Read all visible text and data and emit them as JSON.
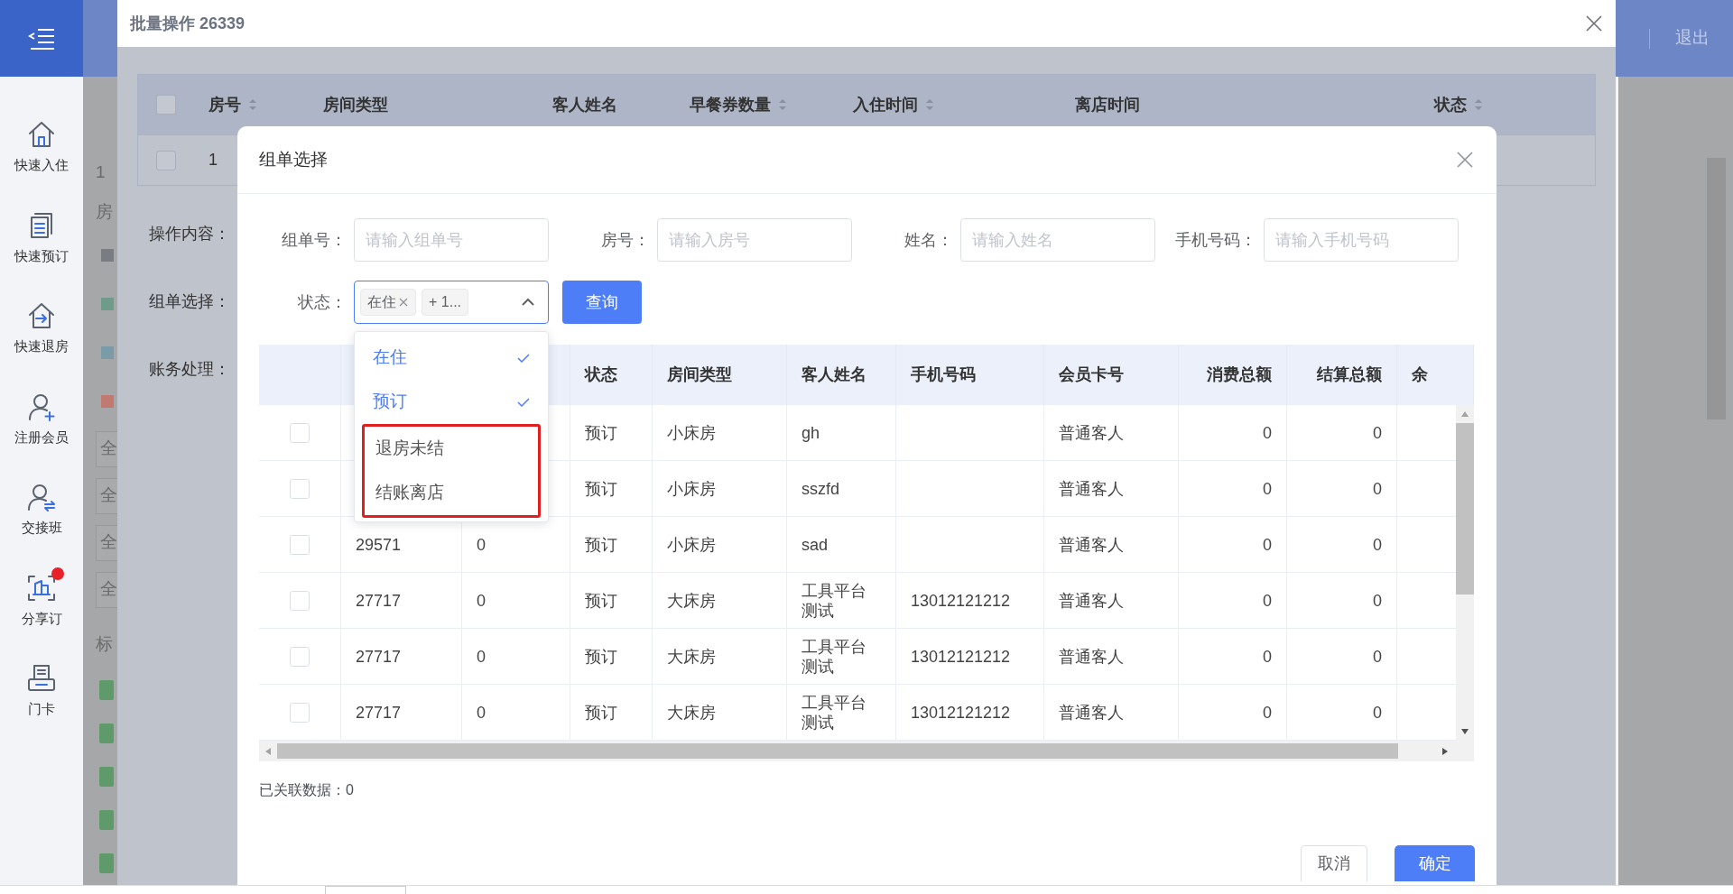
{
  "sidebar": {
    "items": [
      {
        "label": "快速入住",
        "notification": false
      },
      {
        "label": "快速预订",
        "notification": false
      },
      {
        "label": "快速退房",
        "notification": false
      },
      {
        "label": "注册会员",
        "notification": false
      },
      {
        "label": "交接班",
        "notification": false
      },
      {
        "label": "分享订",
        "notification": true
      },
      {
        "label": "门卡",
        "notification": false
      }
    ]
  },
  "top_bar": {
    "logout": "退出"
  },
  "background": {
    "row_number": "1",
    "section_labels": [
      "房",
      "标"
    ],
    "buttons": [
      "全",
      "全",
      "全",
      "全"
    ]
  },
  "batch_dialog": {
    "title": "批量操作 26339",
    "table": {
      "columns": [
        {
          "label": "房号",
          "sortable": true
        },
        {
          "label": "房间类型",
          "sortable": false
        },
        {
          "label": "客人姓名",
          "sortable": false
        },
        {
          "label": "早餐券数量",
          "sortable": true
        },
        {
          "label": "入住时间",
          "sortable": true
        },
        {
          "label": "离店时间",
          "sortable": false
        },
        {
          "label": "状态",
          "sortable": true
        }
      ],
      "all_checked": false,
      "rows": [
        {
          "checked": false,
          "cells": [
            "1"
          ]
        }
      ]
    },
    "form_labels": [
      "操作内容：",
      "组单选择：",
      "账务处理："
    ]
  },
  "group_dialog": {
    "title": "组单选择",
    "filters": [
      {
        "label": "组单号：",
        "placeholder": "请输入组单号"
      },
      {
        "label": "房号：",
        "placeholder": "请输入房号"
      },
      {
        "label": "姓名：",
        "placeholder": "请输入姓名"
      },
      {
        "label": "手机号码：",
        "placeholder": "请输入手机号码"
      }
    ],
    "status_filter": {
      "label": "状态：",
      "expanded": true,
      "tags": [
        {
          "text": "在住",
          "closable": true
        },
        {
          "text": "+ 1...",
          "closable": false
        }
      ],
      "options": [
        {
          "label": "在住",
          "selected": true,
          "highlighted": false
        },
        {
          "label": "预订",
          "selected": true,
          "highlighted": false
        },
        {
          "label": "退房未结",
          "selected": false,
          "highlighted": true
        },
        {
          "label": "结账离店",
          "selected": false,
          "highlighted": true
        }
      ]
    },
    "query_button": "查询",
    "table": {
      "columns": [
        "",
        "",
        "状态",
        "房间类型",
        "客人姓名",
        "手机号码",
        "会员卡号",
        "消费总额",
        "结算总额",
        "余"
      ],
      "rows": [
        {
          "checked": false,
          "cells": [
            "",
            "",
            "预订",
            "小床房",
            "gh",
            "",
            "普通客人",
            "0",
            "0"
          ]
        },
        {
          "checked": false,
          "cells": [
            "",
            "",
            "预订",
            "小床房",
            "sszfd",
            "",
            "普通客人",
            "0",
            "0"
          ]
        },
        {
          "checked": false,
          "cells": [
            "29571",
            "0",
            "预订",
            "小床房",
            "sad",
            "",
            "普通客人",
            "0",
            "0"
          ]
        },
        {
          "checked": false,
          "cells": [
            "27717",
            "0",
            "预订",
            "大床房",
            "工具平台测试",
            "13012121212",
            "普通客人",
            "0",
            "0"
          ]
        },
        {
          "checked": false,
          "cells": [
            "27717",
            "0",
            "预订",
            "大床房",
            "工具平台测试",
            "13012121212",
            "普通客人",
            "0",
            "0"
          ]
        },
        {
          "checked": false,
          "cells": [
            "27717",
            "0",
            "预订",
            "大床房",
            "工具平台测试",
            "13012121212",
            "普通客人",
            "0",
            "0"
          ]
        }
      ]
    },
    "linked_count": "已关联数据：0",
    "buttons": [
      {
        "kind": "cancel",
        "label": "取消"
      },
      {
        "kind": "confirm",
        "label": "确定"
      }
    ]
  }
}
